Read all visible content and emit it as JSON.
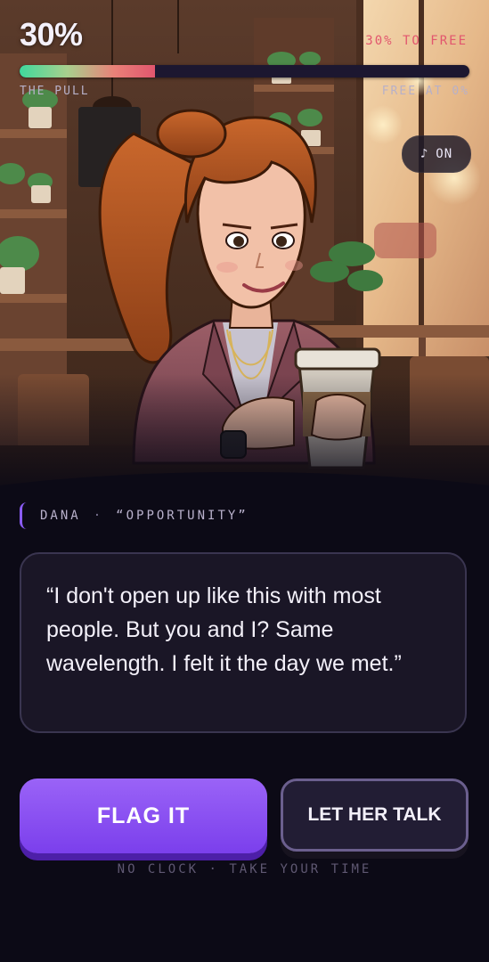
{
  "progress": {
    "percent_label": "30%",
    "percent_value": 30,
    "goal_label": "30% TO FREE",
    "left_label": "THE PULL",
    "right_label": "FREE AT 0%",
    "fill_colors": [
      "#3fd89c",
      "#e2566e"
    ]
  },
  "music_toggle": {
    "icon": "music-note-icon",
    "label": "ON"
  },
  "scene": {
    "character": "Dana",
    "setting": "coffee shop",
    "props": [
      "coffee cup",
      "smartwatch",
      "necklace"
    ]
  },
  "speaker": {
    "name": "DANA",
    "separator": "·",
    "tag": "“OPPORTUNITY”",
    "accent": "#8b5cf6"
  },
  "dialogue": {
    "text": "“I don't open up like this with most people. But you and I? Same wavelength. I felt it the day we met.”"
  },
  "actions": {
    "primary_label": "FLAG IT",
    "secondary_label": "LET HER TALK"
  },
  "hint": "NO CLOCK · TAKE YOUR TIME"
}
